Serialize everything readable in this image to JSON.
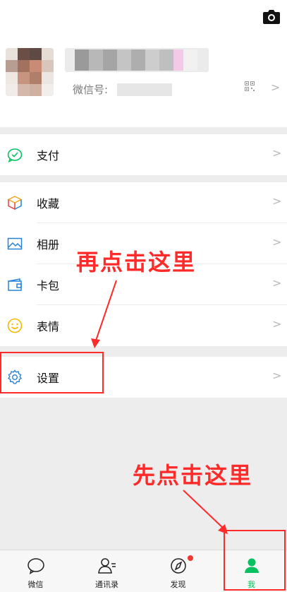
{
  "profile": {
    "wechat_id_label": "微信号:",
    "arrow": ">"
  },
  "menu": [
    {
      "label": "支付",
      "arrow": ">"
    },
    {
      "label": "收藏",
      "arrow": ">"
    },
    {
      "label": "相册",
      "arrow": ">"
    },
    {
      "label": "卡包",
      "arrow": ">"
    },
    {
      "label": "表情",
      "arrow": ">"
    },
    {
      "label": "设置",
      "arrow": ">"
    }
  ],
  "tabs": [
    {
      "label": "微信"
    },
    {
      "label": "通讯录"
    },
    {
      "label": "发现"
    },
    {
      "label": "我"
    }
  ],
  "annotations": {
    "first_step": "再点击这里",
    "second_step": "先点击这里"
  },
  "colors": {
    "accent_green": "#07c160",
    "annotation_red": "#ff2a2a",
    "badge_red": "#f43530"
  }
}
